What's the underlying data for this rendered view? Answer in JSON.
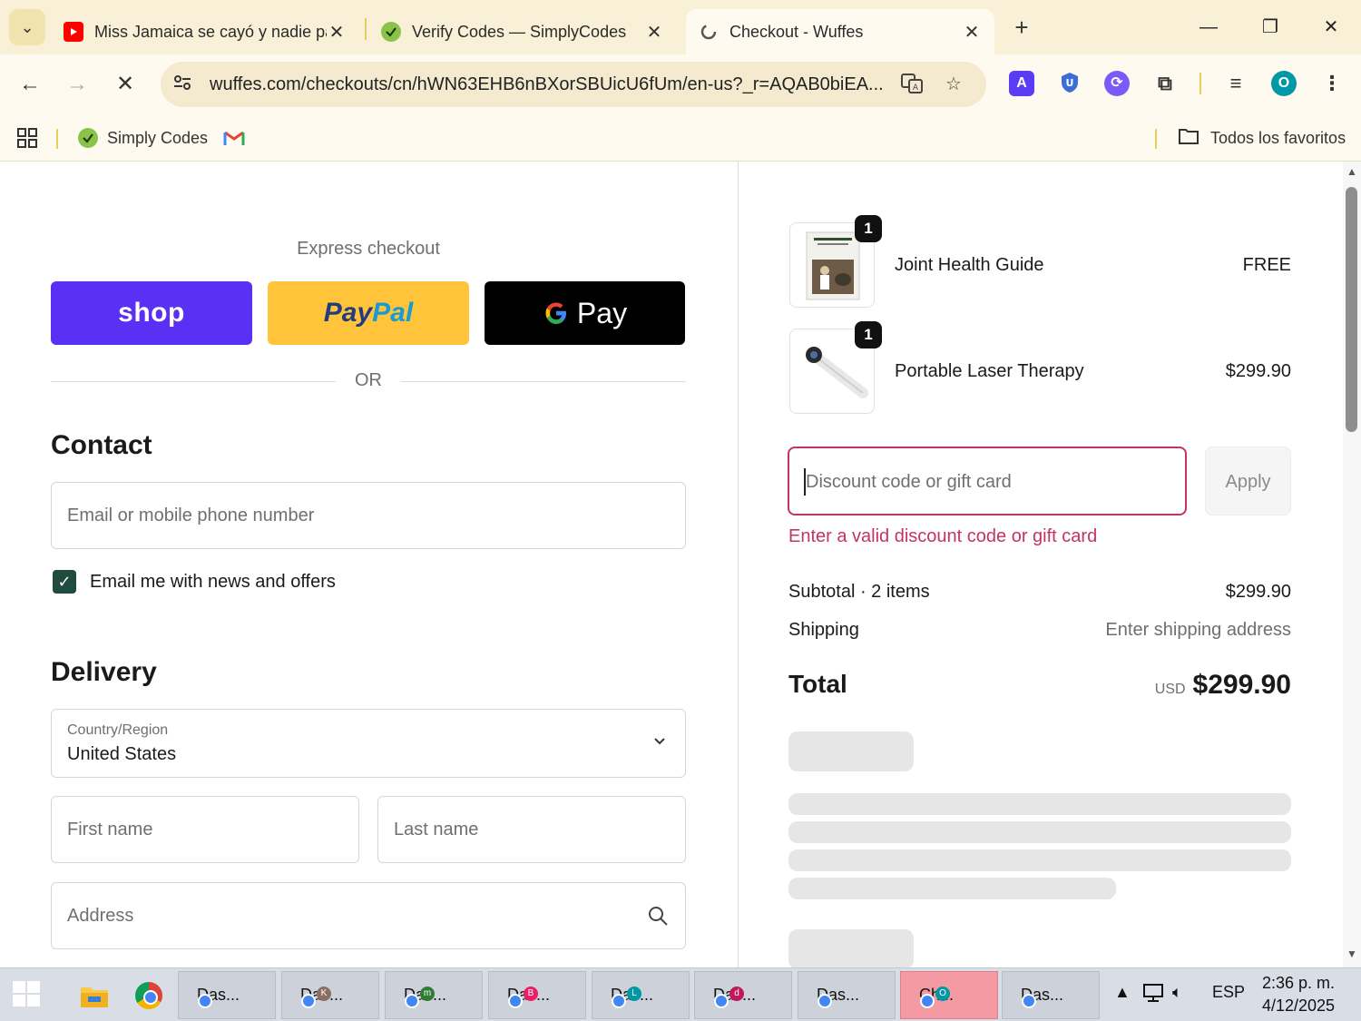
{
  "browser": {
    "tabs": [
      {
        "title": "Miss Jamaica se cayó y nadie pa",
        "favicon": "youtube-icon"
      },
      {
        "title": "Verify Codes — SimplyCodes",
        "favicon": "simplycodes-icon"
      },
      {
        "title": "Checkout - Wuffes",
        "favicon": "loading-icon"
      }
    ],
    "url": "wuffes.com/checkouts/cn/hWN63EHB6nBXorSBUicU6fUm/en-us?_r=AQAB0biEA...",
    "profile_initial": "O",
    "ext_a_label": "A",
    "bookmarks": [
      {
        "label": "Simply Codes"
      }
    ],
    "all_bookmarks_label": "Todos los favoritos"
  },
  "checkout": {
    "express_label": "Express checkout",
    "shop_label": "shop",
    "paypal_label_1": "Pay",
    "paypal_label_2": "Pal",
    "gpay_label": "Pay",
    "or_label": "OR",
    "contact": {
      "heading": "Contact",
      "email_placeholder": "Email or mobile phone number",
      "newsletter_label": "Email me with news and offers",
      "newsletter_checked": true
    },
    "delivery": {
      "heading": "Delivery",
      "country_label": "Country/Region",
      "country_value": "United States",
      "first_name_placeholder": "First name",
      "last_name_placeholder": "Last name",
      "address_placeholder": "Address"
    }
  },
  "summary": {
    "items": [
      {
        "name": "Joint Health Guide",
        "price": "FREE",
        "qty": "1"
      },
      {
        "name": "Portable Laser Therapy",
        "price": "$299.90",
        "qty": "1"
      }
    ],
    "discount_placeholder": "Discount code or gift card",
    "apply_label": "Apply",
    "discount_error": "Enter a valid discount code or gift card",
    "subtotal_label": "Subtotal · 2 items",
    "subtotal_value": "$299.90",
    "shipping_label": "Shipping",
    "shipping_value": "Enter shipping address",
    "total_label": "Total",
    "total_currency": "USD",
    "total_value": "$299.90"
  },
  "taskbar": {
    "apps": [
      {
        "label": "Das...",
        "badge": "",
        "badge_color": ""
      },
      {
        "label": "Das...",
        "badge": "K",
        "badge_color": "#8d6e63"
      },
      {
        "label": "Das...",
        "badge": "m",
        "badge_color": "#2e7d32"
      },
      {
        "label": "Das...",
        "badge": "B",
        "badge_color": "#e91e63"
      },
      {
        "label": "Das...",
        "badge": "L",
        "badge_color": "#0097a7"
      },
      {
        "label": "Das...",
        "badge": "d",
        "badge_color": "#c2185b"
      },
      {
        "label": "Das...",
        "badge": "",
        "badge_color": ""
      },
      {
        "label": "Ch...",
        "badge": "O",
        "badge_color": "#0097a7"
      },
      {
        "label": "Das...",
        "badge": "",
        "badge_color": ""
      }
    ],
    "language": "ESP",
    "time": "2:36 p. m.",
    "date": "4/12/2025"
  },
  "colors": {
    "shop": "#5a31f4",
    "paypal": "#ffc439",
    "error": "#c4326a",
    "checkbox": "#1f4c3f"
  }
}
